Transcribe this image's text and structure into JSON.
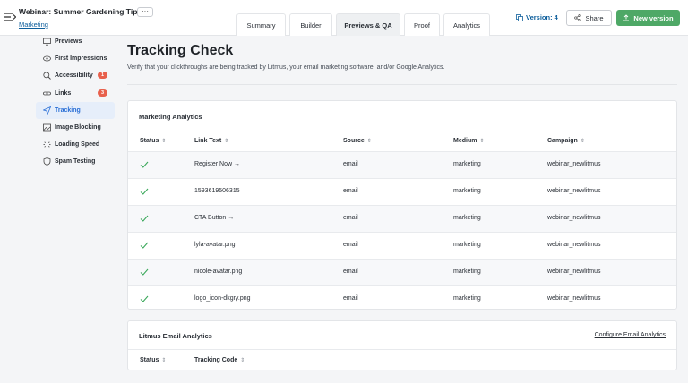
{
  "header": {
    "title": "Webinar: Summer Gardening Tips",
    "more_label": "···",
    "breadcrumb": "Marketing",
    "tabs": [
      {
        "label": "Summary",
        "active": false
      },
      {
        "label": "Builder",
        "active": false
      },
      {
        "label": "Previews & QA",
        "active": true
      },
      {
        "label": "Proof",
        "active": false
      },
      {
        "label": "Analytics",
        "active": false
      }
    ],
    "version_label": "Version: 4",
    "share_label": "Share",
    "new_version_label": "New version"
  },
  "colors": {
    "accent_green": "#4ea866",
    "active_blue": "#2a6fd6",
    "badge_red": "#e8604c",
    "check_green": "#3aa85a"
  },
  "sidebar": {
    "items": [
      {
        "label": "Previews",
        "icon": "monitor-icon",
        "badge": ""
      },
      {
        "label": "First Impressions",
        "icon": "eye-icon",
        "badge": ""
      },
      {
        "label": "Accessibility",
        "icon": "magnifier-icon",
        "badge": "1"
      },
      {
        "label": "Links",
        "icon": "link-icon",
        "badge": "3"
      },
      {
        "label": "Tracking",
        "icon": "send-icon",
        "badge": "",
        "active": true
      },
      {
        "label": "Image Blocking",
        "icon": "image-icon",
        "badge": ""
      },
      {
        "label": "Loading Speed",
        "icon": "spinner-icon",
        "badge": ""
      },
      {
        "label": "Spam Testing",
        "icon": "shield-icon",
        "badge": ""
      }
    ]
  },
  "main": {
    "title": "Tracking Check",
    "description": "Verify that your clickthroughs are being tracked by Litmus, your email marketing software, and/or Google Analytics.",
    "marketing": {
      "title": "Marketing Analytics",
      "columns": [
        "Status",
        "Link Text",
        "Source",
        "Medium",
        "Campaign"
      ],
      "rows": [
        {
          "link": "Register Now →",
          "source": "email",
          "medium": "marketing",
          "campaign": "webinar_newlitmus"
        },
        {
          "link": "1593619506315",
          "source": "email",
          "medium": "marketing",
          "campaign": "webinar_newlitmus"
        },
        {
          "link": "CTA Button →",
          "source": "email",
          "medium": "marketing",
          "campaign": "webinar_newlitmus"
        },
        {
          "link": "lyla-avatar.png",
          "source": "email",
          "medium": "marketing",
          "campaign": "webinar_newlitmus"
        },
        {
          "link": "nicole-avatar.png",
          "source": "email",
          "medium": "marketing",
          "campaign": "webinar_newlitmus"
        },
        {
          "link": "logo_icon-dkgry.png",
          "source": "email",
          "medium": "marketing",
          "campaign": "webinar_newlitmus"
        }
      ]
    },
    "litmus": {
      "title": "Litmus Email Analytics",
      "configure_label": "Configure Email Analytics",
      "columns": [
        "Status",
        "Tracking Code"
      ]
    },
    "sort_glyph": "⇕"
  }
}
